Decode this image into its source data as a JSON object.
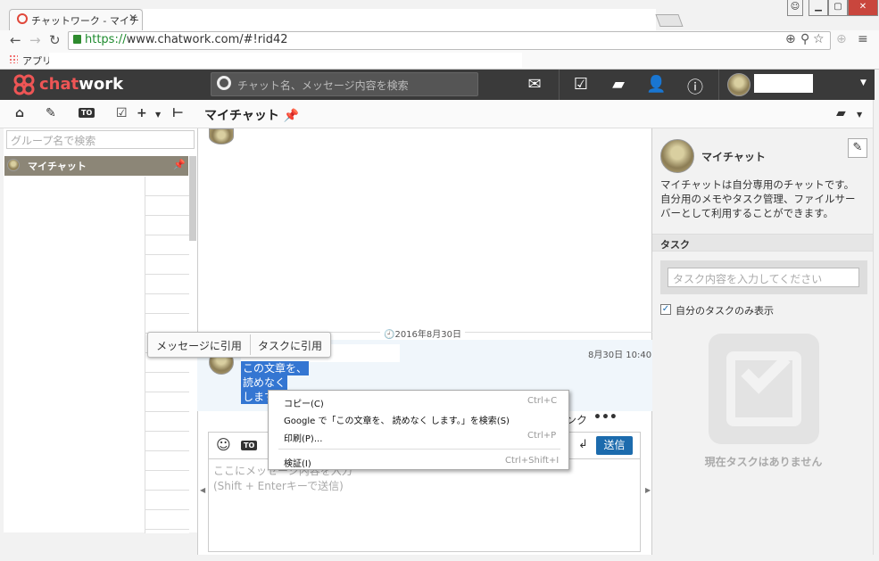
{
  "browser": {
    "tab_title": "チャットワーク - マイチ",
    "url_scheme": "https://",
    "url_rest": "www.chatwork.com/#!rid42",
    "bookmark_apps": "アプリ"
  },
  "header": {
    "logo_text_a": "chat",
    "logo_text_b": "work",
    "search_placeholder": "チャット名、メッセージ内容を検索"
  },
  "toolbar": {
    "to_label": "TO",
    "room_title": "マイチャット"
  },
  "sidebar": {
    "group_search_placeholder": "グループ名で検索",
    "rooms": [
      {
        "label": "マイチャット",
        "selected": true
      }
    ]
  },
  "timeline": {
    "date": "2016年8月30日",
    "message": {
      "time": "8月30日 10:40",
      "lines": [
        "この文章を、",
        "読めなく",
        "します。"
      ],
      "link_fragment": "ンク"
    }
  },
  "quote_popup": {
    "quote_message": "メッセージに引用",
    "quote_task": "タスクに引用"
  },
  "composer": {
    "to_label": "TO",
    "send_label": "送信",
    "placeholder_line1": "ここにメッセージ内容を入力",
    "placeholder_line2": "(Shift + Enterキーで送信)"
  },
  "context_menu": {
    "items": [
      {
        "label": "コピー(C)",
        "shortcut": "Ctrl+C"
      },
      {
        "label": "Google で「この文章を、 読めなく します。」を検索(S)",
        "shortcut": ""
      },
      {
        "label": "印刷(P)...",
        "shortcut": "Ctrl+P"
      },
      {
        "label": "検証(I)",
        "shortcut": "Ctrl+Shift+I"
      }
    ]
  },
  "right_panel": {
    "room_name": "マイチャット",
    "description": "マイチャットは自分専用のチャットです。自分用のメモやタスク管理、ファイルサーバーとして利用することができます。",
    "task_header": "タスク",
    "task_placeholder": "タスク内容を入力してください",
    "only_mine_label": "自分のタスクのみ表示",
    "only_mine_checked": true,
    "empty_text": "現在タスクはありません"
  },
  "colors": {
    "header_bg": "#3a3a3a",
    "accent_blue": "#1c6bad",
    "selection": "#3476d2",
    "logo_red": "#e55555"
  }
}
